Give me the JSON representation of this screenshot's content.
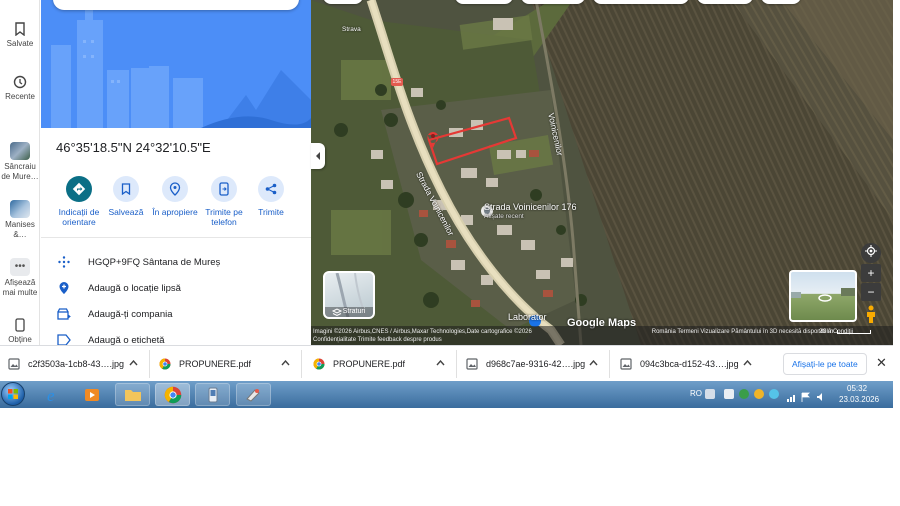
{
  "rail": {
    "items": [
      {
        "label": "Salvate",
        "icon": "bookmark-icon"
      },
      {
        "label": "Recente",
        "icon": "history-icon"
      },
      {
        "label": "Sâncraiu de Mure…",
        "icon": "place-thumbnail"
      },
      {
        "label": "Manises &…",
        "icon": "place-thumbnail"
      },
      {
        "label": "Afișează mai multe",
        "icon": "more-icon"
      },
      {
        "label": "Obține",
        "icon": "phone-icon"
      }
    ]
  },
  "panel": {
    "coordinates": "46°35'18.5\"N 24°32'10.5\"E",
    "actions": [
      {
        "label": "Indicații de orientare",
        "icon": "directions-icon"
      },
      {
        "label": "Salvează",
        "icon": "bookmark-icon"
      },
      {
        "label": "În apropiere",
        "icon": "nearby-icon"
      },
      {
        "label": "Trimite pe telefon",
        "icon": "send-to-phone-icon"
      },
      {
        "label": "Trimite",
        "icon": "share-icon"
      }
    ],
    "info_rows": [
      {
        "text": "HGQP+9FQ Sântana de Mureș",
        "icon": "plus-code-icon"
      },
      {
        "text": "Adaugă o locație lipsă",
        "icon": "add-location-icon"
      },
      {
        "text": "Adaugă-ți compania",
        "icon": "add-business-icon"
      },
      {
        "text": "Adaugă o etichetă",
        "icon": "label-icon"
      }
    ]
  },
  "map": {
    "street_1": "Strada Voinicenilor",
    "street_2": "Voinicenilor",
    "place_name": "Strada Voinicenilor 176",
    "place_sub": "Afișate recent",
    "poi": "Laborator",
    "logo": "Google Maps",
    "road_badge": "15E",
    "layers_label": "Straturi",
    "small_label": "Strava",
    "attribution_left": "Imagini ©2026 Airbus,CNES / Airbus,Maxar Technologies,Date cartografice ©2026",
    "attribution_left_2": "Confidențialitate    Trimite feedback despre produs",
    "attribution_right": "România   Termeni   Vizualizare Pământului în 3D necesită disponibilă   Condiții",
    "scale": "20 m",
    "zoom_in": "+",
    "zoom_out": "−"
  },
  "downloads": {
    "items": [
      {
        "name": "c2f3503a-1cb8-43….jpg",
        "type": "image"
      },
      {
        "name": "PROPUNERE.pdf",
        "type": "pdf"
      },
      {
        "name": "PROPUNERE.pdf",
        "type": "pdf"
      },
      {
        "name": "d968c7ae-9316-42….jpg",
        "type": "image"
      },
      {
        "name": "094c3bca-d152-43….jpg",
        "type": "image"
      }
    ],
    "show_all": "Afișați-le pe toate",
    "close": "✕"
  },
  "taskbar": {
    "language": "RO",
    "time": "05:32",
    "date": "23.03.2026"
  },
  "colors": {
    "accent": "#1a73e8",
    "primary_action": "#0b6f86",
    "pin": "#e53935",
    "taskbar": "#4a7eb0"
  }
}
